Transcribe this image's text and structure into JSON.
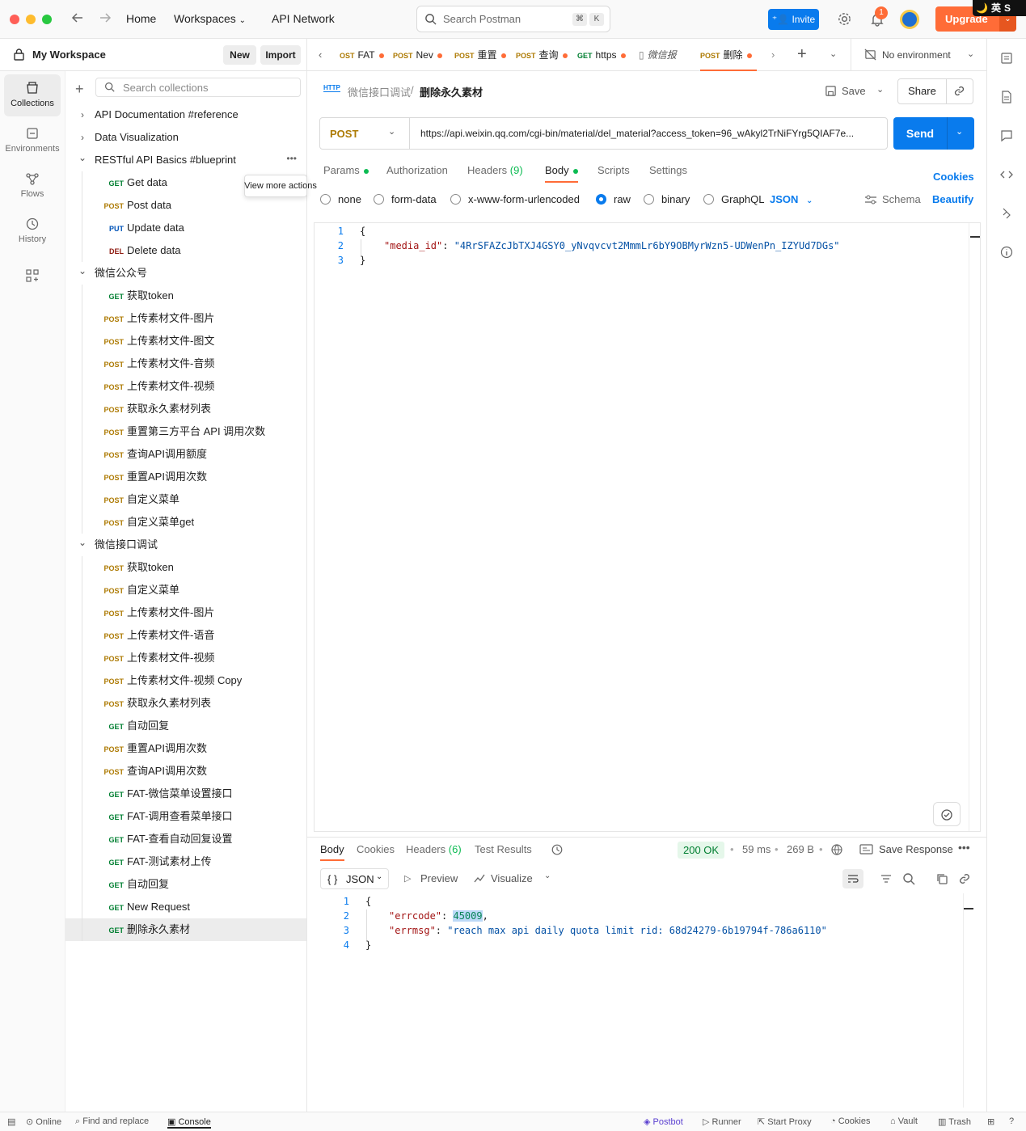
{
  "topbar": {
    "home": "Home",
    "workspaces": "Workspaces",
    "api_network": "API Network",
    "search_placeholder": "Search Postman",
    "kbd_cmd": "⌘",
    "kbd_k": "K",
    "invite": "Invite",
    "notif_count": "1",
    "upgrade": "Upgrade",
    "ime_moon": "🌙",
    "ime_lang": "英",
    "ime_s": "S"
  },
  "workspace": {
    "name": "My Workspace",
    "new": "New",
    "import": "Import"
  },
  "rail": [
    {
      "label": "Collections",
      "icon": "collections-icon"
    },
    {
      "label": "Environments",
      "icon": "environments-icon"
    },
    {
      "label": "Flows",
      "icon": "flows-icon"
    },
    {
      "label": "History",
      "icon": "history-icon"
    }
  ],
  "sidebar_search_placeholder": "Search collections",
  "tooltip": "View more actions",
  "tree": [
    {
      "type": "folder",
      "open": false,
      "label": "API Documentation #reference",
      "indent": 0
    },
    {
      "type": "folder",
      "open": false,
      "label": "Data Visualization",
      "indent": 0
    },
    {
      "type": "folder",
      "open": true,
      "label": "RESTful API Basics #blueprint",
      "indent": 0
    },
    {
      "type": "req",
      "method": "GET",
      "label": "Get data"
    },
    {
      "type": "req",
      "method": "POST",
      "label": "Post data"
    },
    {
      "type": "req",
      "method": "PUT",
      "label": "Update data"
    },
    {
      "type": "req",
      "method": "DEL",
      "label": "Delete data"
    },
    {
      "type": "folder",
      "open": true,
      "label": "微信公众号",
      "indent": 0
    },
    {
      "type": "req",
      "method": "GET",
      "label": "获取token"
    },
    {
      "type": "req",
      "method": "POST",
      "label": "上传素材文件-图片"
    },
    {
      "type": "req",
      "method": "POST",
      "label": "上传素材文件-图文"
    },
    {
      "type": "req",
      "method": "POST",
      "label": "上传素材文件-音频"
    },
    {
      "type": "req",
      "method": "POST",
      "label": "上传素材文件-视频"
    },
    {
      "type": "req",
      "method": "POST",
      "label": "获取永久素材列表"
    },
    {
      "type": "req",
      "method": "POST",
      "label": "重置第三方平台 API 调用次数"
    },
    {
      "type": "req",
      "method": "POST",
      "label": "查询API调用额度"
    },
    {
      "type": "req",
      "method": "POST",
      "label": "重置API调用次数"
    },
    {
      "type": "req",
      "method": "POST",
      "label": "自定义菜单"
    },
    {
      "type": "req",
      "method": "POST",
      "label": "自定义菜单get"
    },
    {
      "type": "folder",
      "open": true,
      "label": "微信接口调试",
      "indent": 0
    },
    {
      "type": "req",
      "method": "POST",
      "label": "获取token"
    },
    {
      "type": "req",
      "method": "POST",
      "label": "自定义菜单"
    },
    {
      "type": "req",
      "method": "POST",
      "label": "上传素材文件-图片"
    },
    {
      "type": "req",
      "method": "POST",
      "label": "上传素材文件-语音"
    },
    {
      "type": "req",
      "method": "POST",
      "label": "上传素材文件-视频"
    },
    {
      "type": "req",
      "method": "POST",
      "label": "上传素材文件-视频 Copy"
    },
    {
      "type": "req",
      "method": "POST",
      "label": "获取永久素材列表"
    },
    {
      "type": "req",
      "method": "GET",
      "label": "自动回复"
    },
    {
      "type": "req",
      "method": "POST",
      "label": "重置API调用次数"
    },
    {
      "type": "req",
      "method": "POST",
      "label": "查询API调用次数"
    },
    {
      "type": "req",
      "method": "GET",
      "label": "FAT-微信菜单设置接口"
    },
    {
      "type": "req",
      "method": "GET",
      "label": "FAT-调用查看菜单接口"
    },
    {
      "type": "req",
      "method": "GET",
      "label": "FAT-查看自动回复设置"
    },
    {
      "type": "req",
      "method": "GET",
      "label": "FAT-测试素材上传"
    },
    {
      "type": "req",
      "method": "GET",
      "label": "自动回复"
    },
    {
      "type": "req",
      "method": "GET",
      "label": "New Request"
    },
    {
      "type": "req",
      "method": "GET",
      "label": "删除永久素材",
      "selected": true
    }
  ],
  "tabs": [
    {
      "method": "OST",
      "label": "FAT"
    },
    {
      "method": "POST",
      "label": "Nev"
    },
    {
      "method": "POST",
      "label": "重置"
    },
    {
      "method": "POST",
      "label": "查询"
    },
    {
      "method": "GET",
      "label": "https"
    },
    {
      "method": "",
      "label": "微信报"
    },
    {
      "method": "POST",
      "label": "删除",
      "active": true
    }
  ],
  "environment": "No environment",
  "breadcrumb": {
    "parent": "微信接口调试",
    "sep": "/",
    "current": "删除永久素材"
  },
  "request": {
    "save": "Save",
    "share": "Share",
    "method": "POST",
    "url": "https://api.weixin.qq.com/cgi-bin/material/del_material?access_token=96_wAkyl2TrNiFYrg5QIAF7e...",
    "send": "Send"
  },
  "req_tabs": {
    "params": "Params",
    "auth": "Authorization",
    "headers": "Headers",
    "headers_count": "(9)",
    "body": "Body",
    "scripts": "Scripts",
    "settings": "Settings",
    "cookies": "Cookies"
  },
  "body_modes": {
    "none": "none",
    "form_data": "form-data",
    "urlencoded": "x-www-form-urlencoded",
    "raw": "raw",
    "binary": "binary",
    "graphql": "GraphQL",
    "json": "JSON",
    "schema": "Schema",
    "beautify": "Beautify"
  },
  "req_body": {
    "lines": [
      "1",
      "2",
      "3"
    ],
    "open": "{",
    "key": "\"media_id\"",
    "colon": ": ",
    "value": "\"4RrSFAZcJbTXJ4GSY0_yNvqvcvt2MmmLr6bY9OBMyrWzn5-UDWenPn_IZYUd7DGs\"",
    "close": "}"
  },
  "resp_tabs": {
    "body": "Body",
    "cookies": "Cookies",
    "headers": "Headers",
    "headers_count": "(6)",
    "tests": "Test Results"
  },
  "resp_meta": {
    "status": "200 OK",
    "sep": "•",
    "time": "59 ms",
    "size": "269 B",
    "save": "Save Response"
  },
  "resp_toolbar": {
    "format": "JSON",
    "brace": "{ }",
    "preview": "Preview",
    "visualize": "Visualize"
  },
  "resp_body": {
    "lines": [
      "1",
      "2",
      "3",
      "4"
    ],
    "open": "{",
    "k1": "\"errcode\"",
    "v1": "45009",
    "comma": ",",
    "k2": "\"errmsg\"",
    "v2": "\"reach max api daily quota limit rid: 68d24279-6b19794f-786a6110\"",
    "colon": ": ",
    "close": "}"
  },
  "statusbar": {
    "online": "Online",
    "find": "Find and replace",
    "console": "Console",
    "postbot": "Postbot",
    "runner": "Runner",
    "proxy": "Start Proxy",
    "cookies": "Cookies",
    "vault": "Vault",
    "trash": "Trash"
  },
  "colors": {
    "accent": "#ff6c37",
    "blue": "#097bed",
    "post": "#ad7a03",
    "get": "#007f31"
  }
}
